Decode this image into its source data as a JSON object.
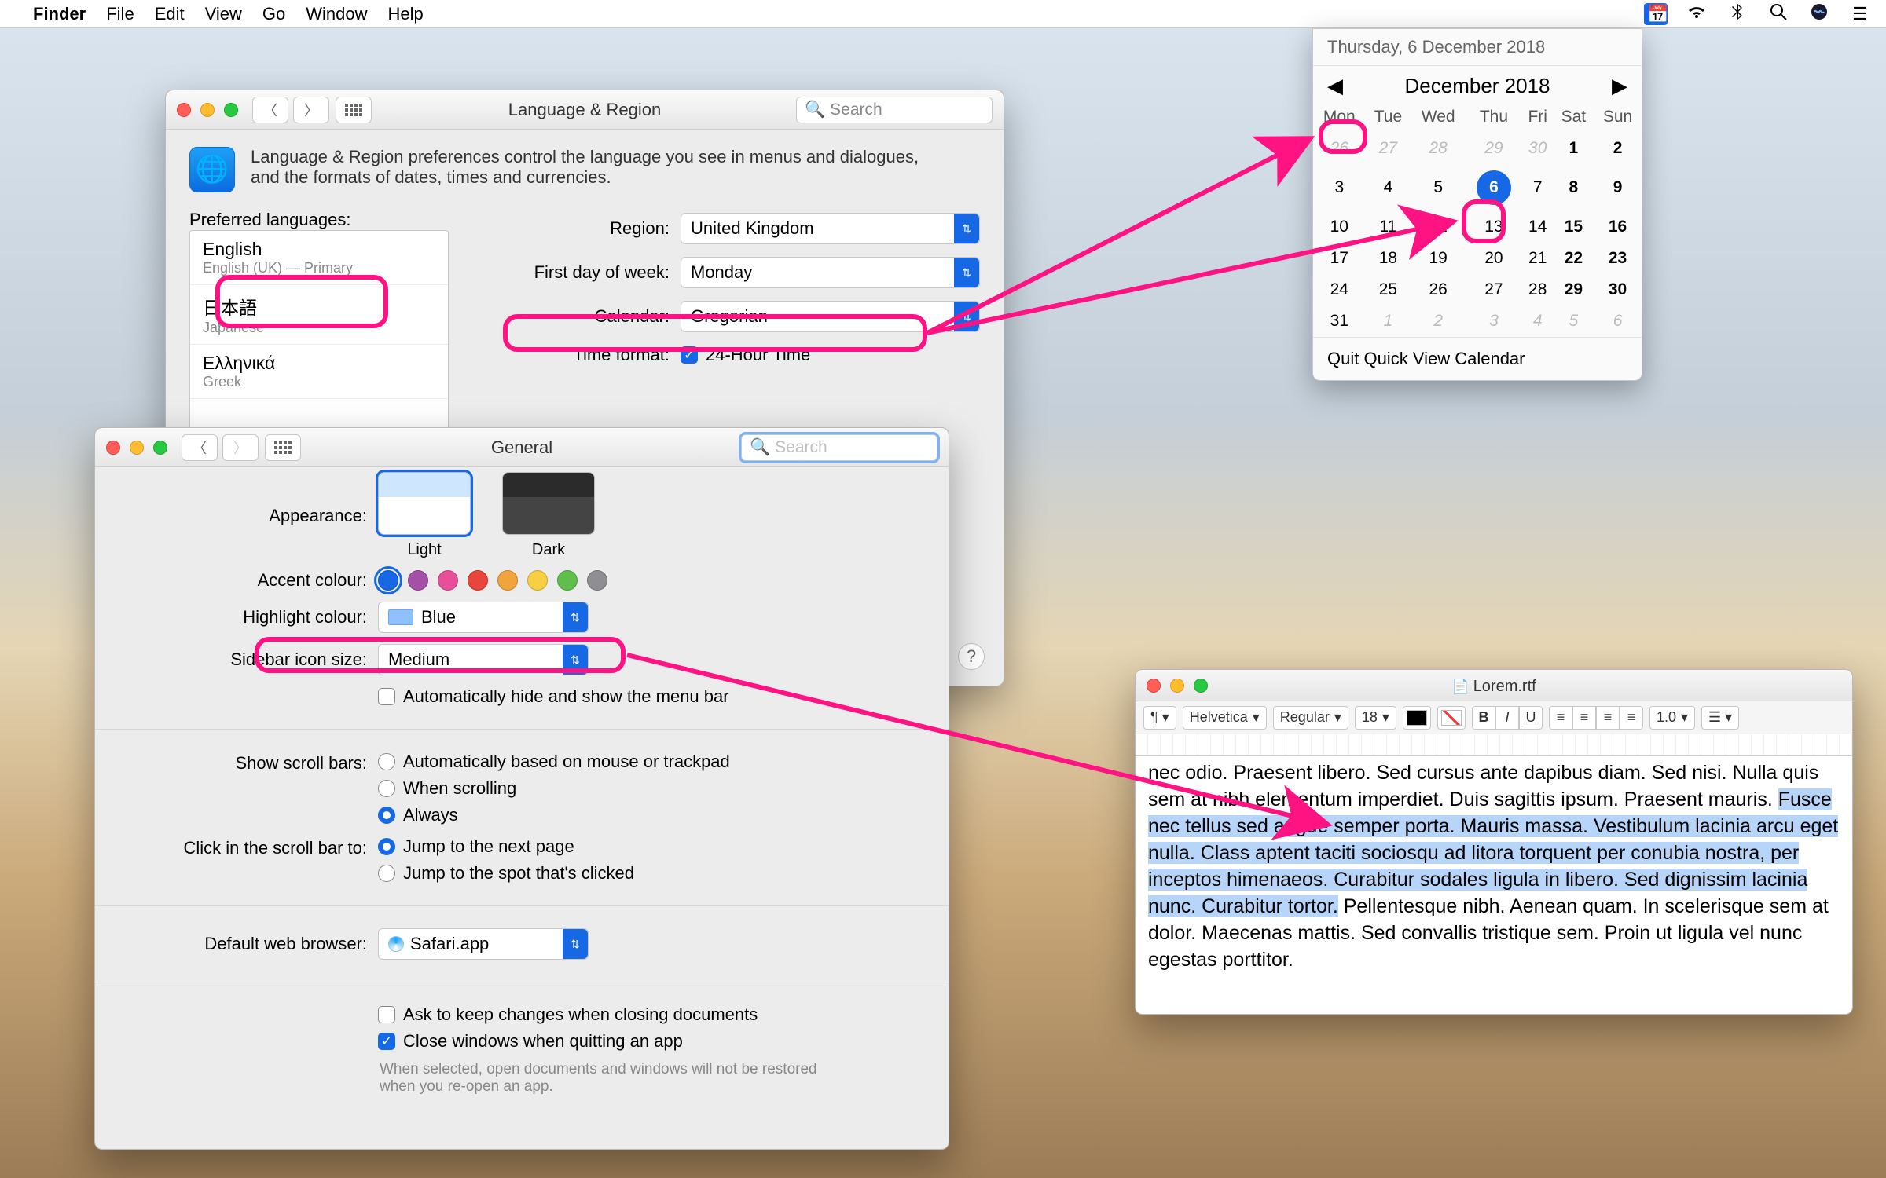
{
  "menubar": {
    "app": "Finder",
    "items": [
      "File",
      "Edit",
      "View",
      "Go",
      "Window",
      "Help"
    ]
  },
  "lr": {
    "title": "Language & Region",
    "search_placeholder": "Search",
    "intro": "Language & Region preferences control the language you see in menus and dialogues, and the formats of dates, times and currencies.",
    "preferred_label": "Preferred languages:",
    "languages": [
      {
        "name": "English",
        "sub": "English (UK) — Primary"
      },
      {
        "name": "日本語",
        "sub": "Japanese"
      },
      {
        "name": "Ελληνικά",
        "sub": "Greek"
      }
    ],
    "region_label": "Region:",
    "region_value": "United Kingdom",
    "dow_label": "First day of week:",
    "dow_value": "Monday",
    "calendar_label": "Calendar:",
    "calendar_value": "Gregorian",
    "time_label": "Time format:",
    "time_value": "24-Hour Time"
  },
  "gen": {
    "title": "General",
    "search_placeholder": "Search",
    "appearance_label": "Appearance:",
    "appearance_light": "Light",
    "appearance_dark": "Dark",
    "accent_label": "Accent colour:",
    "accent_colors": [
      "#1668e5",
      "#a450a6",
      "#e84f9a",
      "#e8453c",
      "#f2a43c",
      "#f6cf42",
      "#5fbf4a",
      "#8e8e93"
    ],
    "highlight_label": "Highlight colour:",
    "highlight_value": "Blue",
    "sidebar_label": "Sidebar icon size:",
    "sidebar_value": "Medium",
    "autohide_label": "Automatically hide and show the menu bar",
    "scroll_label": "Show scroll bars:",
    "scroll_opts": [
      "Automatically based on mouse or trackpad",
      "When scrolling",
      "Always"
    ],
    "scroll_selected": 2,
    "click_label": "Click in the scroll bar to:",
    "click_opts": [
      "Jump to the next page",
      "Jump to the spot that's clicked"
    ],
    "click_selected": 0,
    "browser_label": "Default web browser:",
    "browser_value": "Safari.app",
    "ask_label": "Ask to keep changes when closing documents",
    "close_label": "Close windows when quitting an app",
    "close_note": "When selected, open documents and windows will not be restored when you re-open an app."
  },
  "cal": {
    "header": "Thursday, 6 December 2018",
    "month": "December 2018",
    "dows": [
      "Mon",
      "Tue",
      "Wed",
      "Thu",
      "Fri",
      "Sat",
      "Sun"
    ],
    "weeks": [
      [
        {
          "d": 26,
          "o": 1
        },
        {
          "d": 27,
          "o": 1
        },
        {
          "d": 28,
          "o": 1
        },
        {
          "d": 29,
          "o": 1
        },
        {
          "d": 30,
          "o": 1
        },
        {
          "d": 1,
          "w": 1
        },
        {
          "d": 2,
          "w": 1
        }
      ],
      [
        {
          "d": 3
        },
        {
          "d": 4
        },
        {
          "d": 5
        },
        {
          "d": 6,
          "t": 1
        },
        {
          "d": 7
        },
        {
          "d": 8,
          "w": 1
        },
        {
          "d": 9,
          "w": 1
        }
      ],
      [
        {
          "d": 10
        },
        {
          "d": 11
        },
        {
          "d": 12
        },
        {
          "d": 13
        },
        {
          "d": 14
        },
        {
          "d": 15,
          "w": 1
        },
        {
          "d": 16,
          "w": 1
        }
      ],
      [
        {
          "d": 17
        },
        {
          "d": 18
        },
        {
          "d": 19
        },
        {
          "d": 20
        },
        {
          "d": 21
        },
        {
          "d": 22,
          "w": 1
        },
        {
          "d": 23,
          "w": 1
        }
      ],
      [
        {
          "d": 24
        },
        {
          "d": 25
        },
        {
          "d": 26
        },
        {
          "d": 27
        },
        {
          "d": 28
        },
        {
          "d": 29,
          "w": 1
        },
        {
          "d": 30,
          "w": 1
        }
      ],
      [
        {
          "d": 31
        },
        {
          "d": 1,
          "o": 1
        },
        {
          "d": 2,
          "o": 1
        },
        {
          "d": 3,
          "o": 1
        },
        {
          "d": 4,
          "o": 1
        },
        {
          "d": 5,
          "o": 1
        },
        {
          "d": 6,
          "o": 1
        }
      ]
    ],
    "quit": "Quit Quick View Calendar"
  },
  "te": {
    "title": "Lorem.rtf",
    "font": "Helvetica",
    "weight": "Regular",
    "size": "18",
    "linesp": "1.0",
    "pre": "nec odio. Praesent libero. Sed cursus ante dapibus diam. Sed nisi. Nulla quis sem at nibh elementum imperdiet. Duis sagittis ipsum. Praesent mauris. ",
    "hl": "Fusce nec tellus sed augue semper porta. Mauris massa. Vestibulum lacinia arcu eget nulla. Class aptent taciti sociosqu ad litora torquent per conubia nostra, per inceptos himenaeos. Curabitur sodales ligula in libero. Sed dignissim lacinia nunc. Curabitur tortor.",
    "post": " Pellentesque nibh. Aenean quam. In scelerisque sem at dolor. Maecenas mattis. Sed convallis tristique sem. Proin ut ligula vel nunc egestas porttitor."
  }
}
